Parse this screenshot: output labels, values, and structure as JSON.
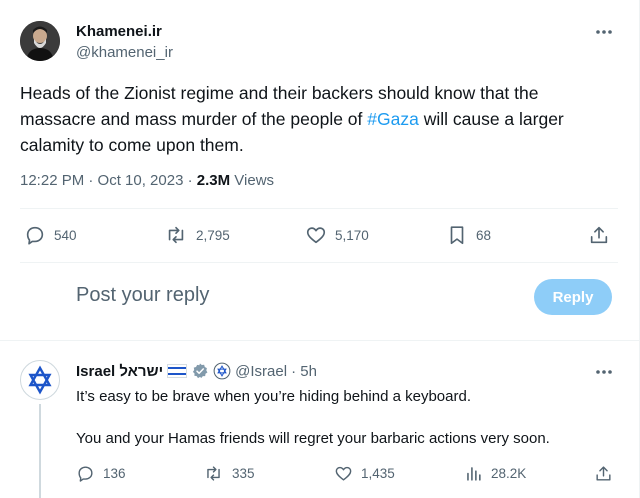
{
  "main_tweet": {
    "author_name": "Khamenei.ir",
    "author_handle": "@khamenei_ir",
    "text_before": "Heads of the Zionist regime and their backers should know that the massacre and mass murder of the people of ",
    "hashtag": "#Gaza",
    "text_after": " will cause a larger calamity to come upon them.",
    "time": "12:22 PM · Oct 10, 2023 · ",
    "views_count": "2.3M",
    "views_label": " Views",
    "stats": {
      "replies": "540",
      "retweets": "2,795",
      "likes": "5,170",
      "bookmarks": "68"
    }
  },
  "composer": {
    "placeholder": "Post your reply",
    "button_label": "Reply"
  },
  "reply_tweet": {
    "author_name": "Israel ישראל",
    "author_handle": "@Israel",
    "time": "· 5h",
    "line1": "It’s easy to be brave when you’re hiding behind a keyboard.",
    "line2": "You and your Hamas friends will regret your barbaric actions very soon.",
    "stats": {
      "replies": "136",
      "retweets": "335",
      "likes": "1,435",
      "views": "28.2K"
    }
  },
  "colors": {
    "accent": "#1d9bf0",
    "reply_button_disabled": "#8ecdf8",
    "secondary_text": "#536471",
    "flag_blue": "#1d55c9"
  },
  "icons": [
    "more-icon",
    "reply-icon",
    "retweet-icon",
    "like-icon",
    "bookmark-icon",
    "share-icon",
    "views-icon",
    "verified-icon",
    "flag-icon",
    "star-of-david-icon"
  ]
}
